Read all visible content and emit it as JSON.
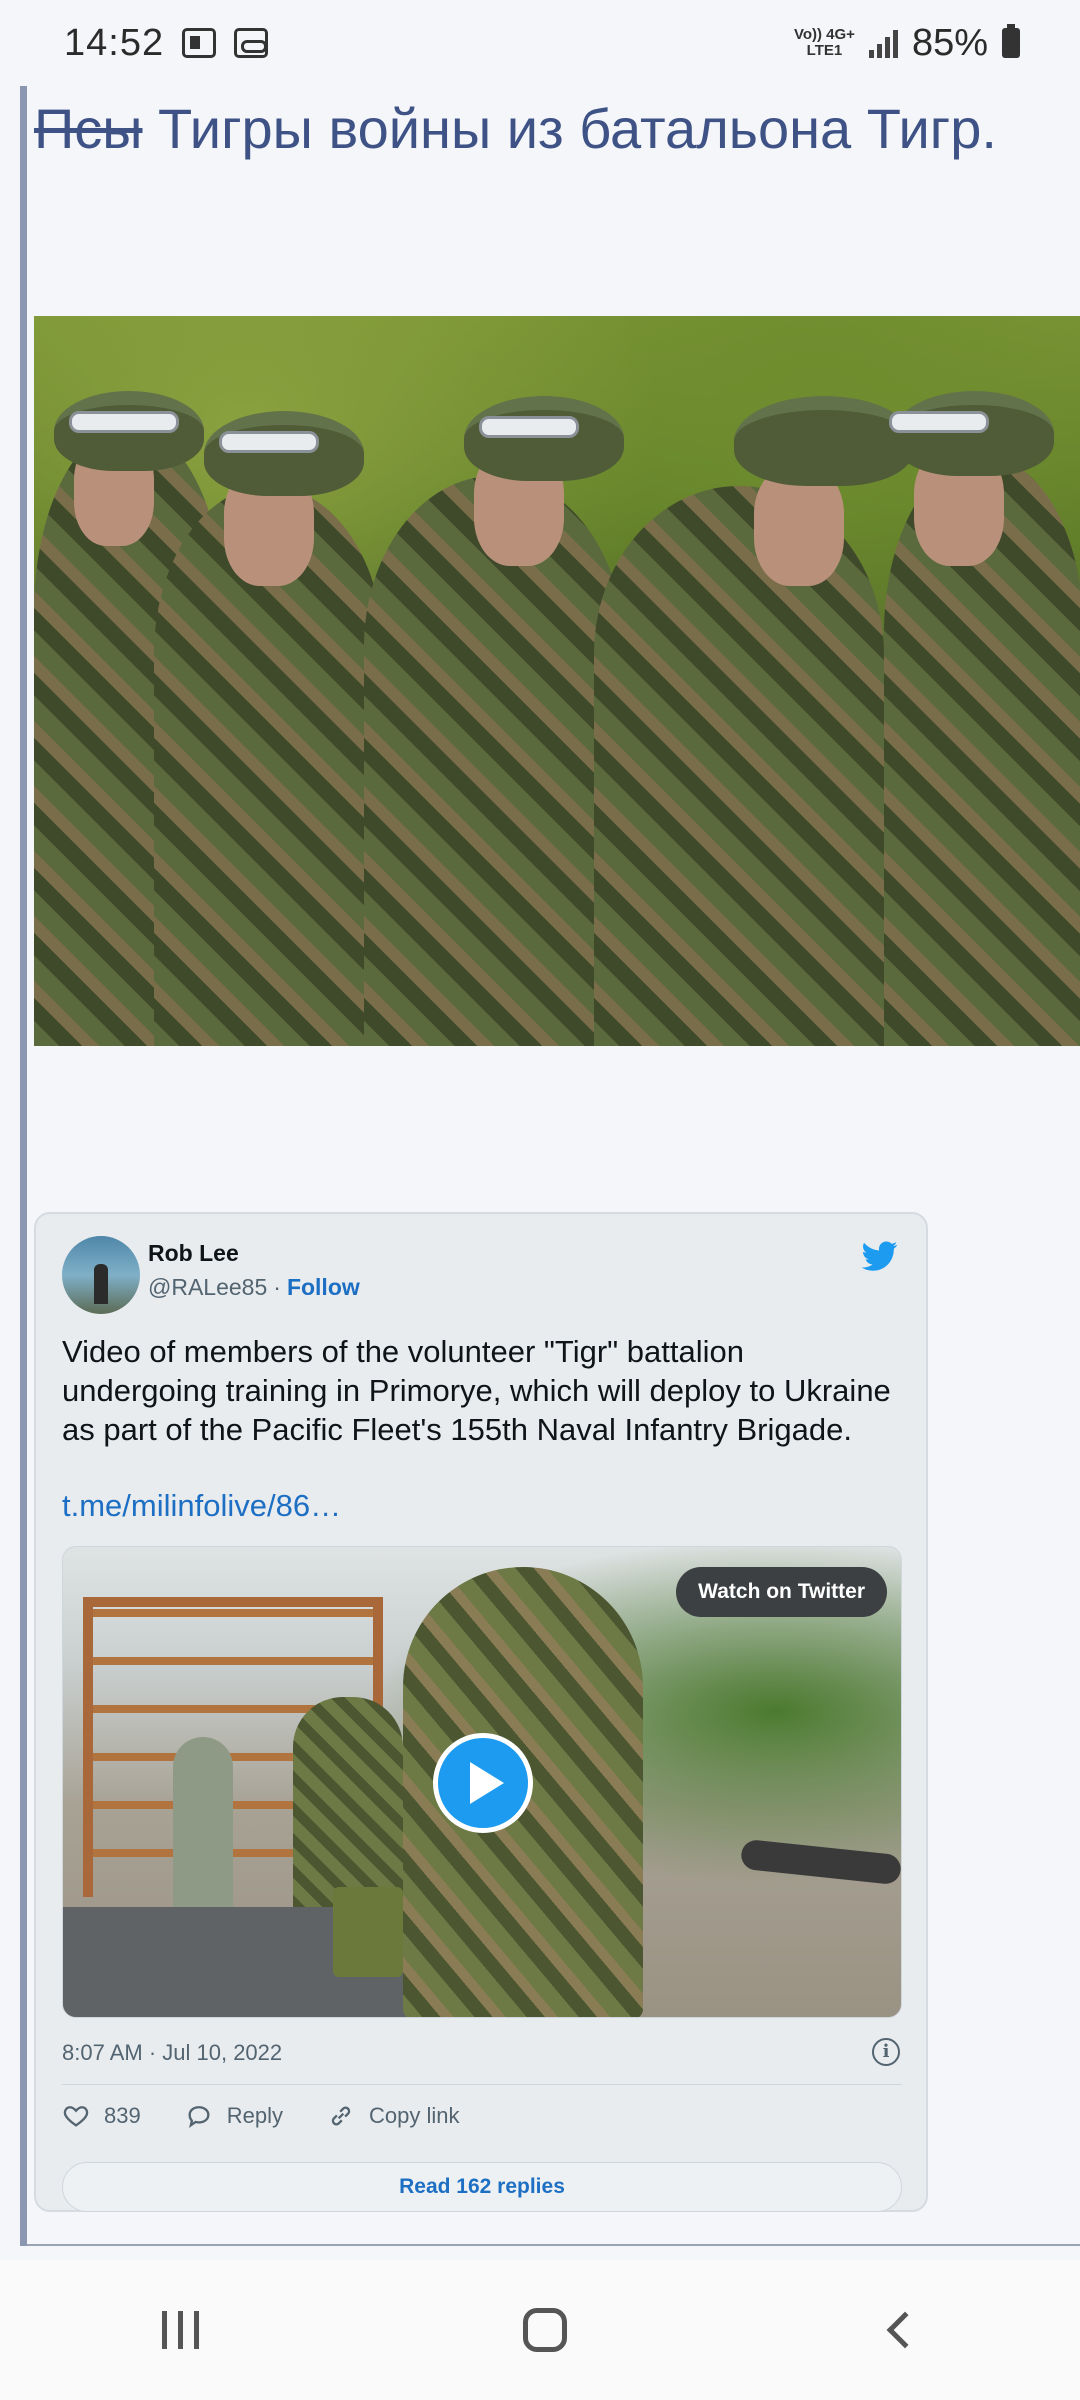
{
  "status_bar": {
    "time": "14:52",
    "network_label_top": "Vo)) 4G+",
    "network_label_bottom": "LTE1",
    "battery_percent": "85%",
    "icons": [
      "news-icon",
      "voicemail-icon",
      "signal-icon",
      "battery-icon"
    ]
  },
  "article": {
    "headline_struck": "Псы",
    "headline_rest": " Тигры войны из батальона Тигр."
  },
  "tweet": {
    "author_name": "Rob Lee",
    "author_handle": "@RALee85",
    "separator": "·",
    "follow_label": "Follow",
    "text": "Video of members of the volunteer \"Tigr\" battalion undergoing training in Primorye, which will deploy to Ukraine as part of the Pacific Fleet's 155th Naval Infantry Brigade.",
    "link": "t.me/milinfolive/86…",
    "watch_label": "Watch on Twitter",
    "timestamp": "8:07 AM · Jul 10, 2022",
    "info_symbol": "i",
    "likes": "839",
    "reply_label": "Reply",
    "copy_link_label": "Copy link",
    "read_replies_label": "Read 162 replies"
  },
  "colors": {
    "link_blue": "#1d6fc4",
    "headline_blue": "#3e5286",
    "twitter_blue": "#1d9bf0"
  }
}
